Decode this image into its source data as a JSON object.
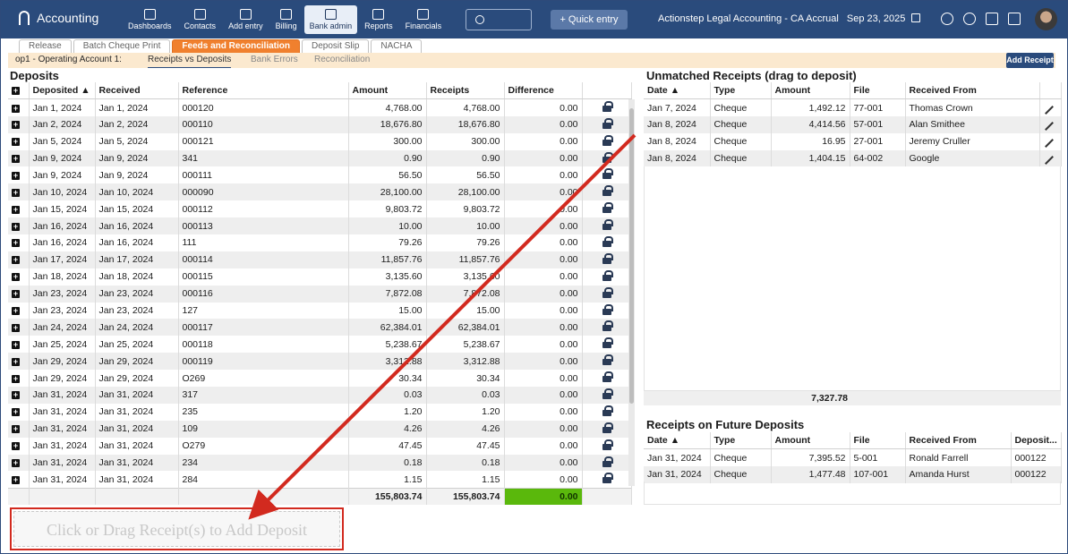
{
  "app": {
    "title": "Accounting"
  },
  "nav": [
    {
      "label": "Dashboards",
      "icon": "dashboard-icon"
    },
    {
      "label": "Contacts",
      "icon": "contacts-icon"
    },
    {
      "label": "Add entry",
      "icon": "add-entry-icon"
    },
    {
      "label": "Billing",
      "icon": "billing-icon"
    },
    {
      "label": "Bank admin",
      "icon": "bank-icon"
    },
    {
      "label": "Reports",
      "icon": "reports-icon"
    },
    {
      "label": "Financials",
      "icon": "financials-icon"
    }
  ],
  "header": {
    "quick_entry": "+ Quick entry",
    "context": "Actionstep Legal Accounting - CA Accrual",
    "date": "Sep 23, 2025"
  },
  "tabs": [
    "Release",
    "Batch Cheque Print",
    "Feeds and Reconciliation",
    "Deposit Slip",
    "NACHA"
  ],
  "subbar": {
    "account": "op1 - Operating Account 1:",
    "subtabs": [
      "Receipts vs Deposits",
      "Bank Errors",
      "Reconciliation"
    ],
    "add_receipt": "Add Receipt"
  },
  "deposits": {
    "title": "Deposits",
    "headers": [
      "Deposited",
      "Received",
      "Reference",
      "Amount",
      "Receipts",
      "Difference"
    ],
    "rows": [
      [
        "Jan 1, 2024",
        "Jan 1, 2024",
        "000120",
        "4,768.00",
        "4,768.00",
        "0.00"
      ],
      [
        "Jan 2, 2024",
        "Jan 2, 2024",
        "000110",
        "18,676.80",
        "18,676.80",
        "0.00"
      ],
      [
        "Jan 5, 2024",
        "Jan 5, 2024",
        "000121",
        "300.00",
        "300.00",
        "0.00"
      ],
      [
        "Jan 9, 2024",
        "Jan 9, 2024",
        "341",
        "0.90",
        "0.90",
        "0.00"
      ],
      [
        "Jan 9, 2024",
        "Jan 9, 2024",
        "000111",
        "56.50",
        "56.50",
        "0.00"
      ],
      [
        "Jan 10, 2024",
        "Jan 10, 2024",
        "000090",
        "28,100.00",
        "28,100.00",
        "0.00"
      ],
      [
        "Jan 15, 2024",
        "Jan 15, 2024",
        "000112",
        "9,803.72",
        "9,803.72",
        "0.00"
      ],
      [
        "Jan 16, 2024",
        "Jan 16, 2024",
        "000113",
        "10.00",
        "10.00",
        "0.00"
      ],
      [
        "Jan 16, 2024",
        "Jan 16, 2024",
        "111",
        "79.26",
        "79.26",
        "0.00"
      ],
      [
        "Jan 17, 2024",
        "Jan 17, 2024",
        "000114",
        "11,857.76",
        "11,857.76",
        "0.00"
      ],
      [
        "Jan 18, 2024",
        "Jan 18, 2024",
        "000115",
        "3,135.60",
        "3,135.60",
        "0.00"
      ],
      [
        "Jan 23, 2024",
        "Jan 23, 2024",
        "000116",
        "7,872.08",
        "7,872.08",
        "0.00"
      ],
      [
        "Jan 23, 2024",
        "Jan 23, 2024",
        "127",
        "15.00",
        "15.00",
        "0.00"
      ],
      [
        "Jan 24, 2024",
        "Jan 24, 2024",
        "000117",
        "62,384.01",
        "62,384.01",
        "0.00"
      ],
      [
        "Jan 25, 2024",
        "Jan 25, 2024",
        "000118",
        "5,238.67",
        "5,238.67",
        "0.00"
      ],
      [
        "Jan 29, 2024",
        "Jan 29, 2024",
        "000119",
        "3,312.88",
        "3,312.88",
        "0.00"
      ],
      [
        "Jan 29, 2024",
        "Jan 29, 2024",
        "O269",
        "30.34",
        "30.34",
        "0.00"
      ],
      [
        "Jan 31, 2024",
        "Jan 31, 2024",
        "317",
        "0.03",
        "0.03",
        "0.00"
      ],
      [
        "Jan 31, 2024",
        "Jan 31, 2024",
        "235",
        "1.20",
        "1.20",
        "0.00"
      ],
      [
        "Jan 31, 2024",
        "Jan 31, 2024",
        "109",
        "4.26",
        "4.26",
        "0.00"
      ],
      [
        "Jan 31, 2024",
        "Jan 31, 2024",
        "O279",
        "47.45",
        "47.45",
        "0.00"
      ],
      [
        "Jan 31, 2024",
        "Jan 31, 2024",
        "234",
        "0.18",
        "0.18",
        "0.00"
      ],
      [
        "Jan 31, 2024",
        "Jan 31, 2024",
        "284",
        "1.15",
        "1.15",
        "0.00"
      ]
    ],
    "totals": {
      "amount": "155,803.74",
      "receipts": "155,803.74",
      "difference": "0.00"
    }
  },
  "unmatched": {
    "title": "Unmatched Receipts (drag to deposit)",
    "headers": [
      "Date",
      "Type",
      "Amount",
      "File",
      "Received From"
    ],
    "rows": [
      [
        "Jan 7, 2024",
        "Cheque",
        "1,492.12",
        "77-001",
        "Thomas Crown"
      ],
      [
        "Jan 8, 2024",
        "Cheque",
        "4,414.56",
        "57-001",
        "Alan Smithee"
      ],
      [
        "Jan 8, 2024",
        "Cheque",
        "16.95",
        "27-001",
        "Jeremy Cruller"
      ],
      [
        "Jan 8, 2024",
        "Cheque",
        "1,404.15",
        "64-002",
        "Google"
      ]
    ],
    "total": "7,327.78"
  },
  "future": {
    "title": "Receipts on Future Deposits",
    "headers": [
      "Date",
      "Type",
      "Amount",
      "File",
      "Received From",
      "Deposit..."
    ],
    "rows": [
      [
        "Jan 31, 2024",
        "Cheque",
        "7,395.52",
        "5-001",
        "Ronald Farrell",
        "000122"
      ],
      [
        "Jan 31, 2024",
        "Cheque",
        "1,477.48",
        "107-001",
        "Amanda Hurst",
        "000122"
      ]
    ]
  },
  "dropzone": {
    "label": "Click or Drag Receipt(s) to Add Deposit"
  },
  "colors": {
    "nav": "#2a4b7c",
    "active_tab": "#f0802e",
    "difference_ok": "#5ab80c",
    "annotation": "#d22a1f"
  }
}
